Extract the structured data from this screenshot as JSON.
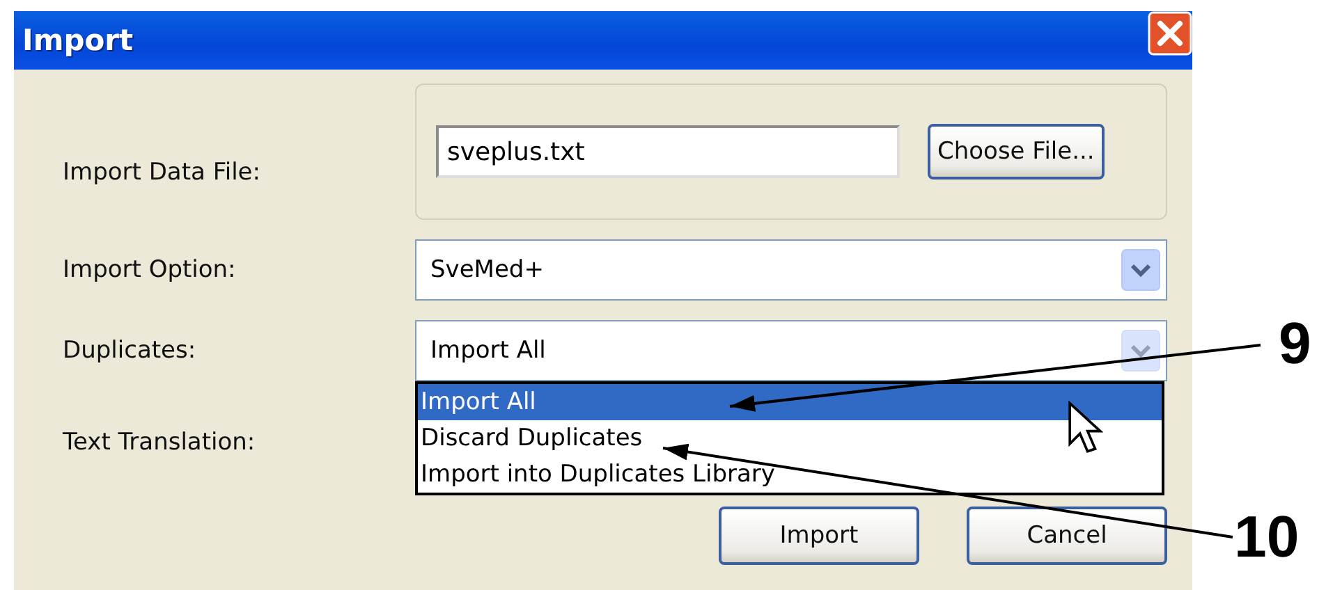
{
  "window": {
    "title": "Import"
  },
  "fields": [
    {
      "label": "Import Data File:",
      "kind": "file",
      "value": "sveplus.txt",
      "button": "Choose File..."
    },
    {
      "label": "Import Option:",
      "kind": "select",
      "value": "SveMed+",
      "open": false
    },
    {
      "label": "Duplicates:",
      "kind": "select",
      "value": "Import All",
      "open": true,
      "options": [
        {
          "label": "Import All",
          "selected": true
        },
        {
          "label": "Discard Duplicates",
          "selected": false
        },
        {
          "label": "Import into Duplicates Library",
          "selected": false
        }
      ]
    },
    {
      "label": "Text Translation:",
      "kind": "covered"
    }
  ],
  "buttons": [
    "Import",
    "Cancel"
  ],
  "callouts": [
    {
      "label": "9"
    },
    {
      "label": "10"
    }
  ]
}
